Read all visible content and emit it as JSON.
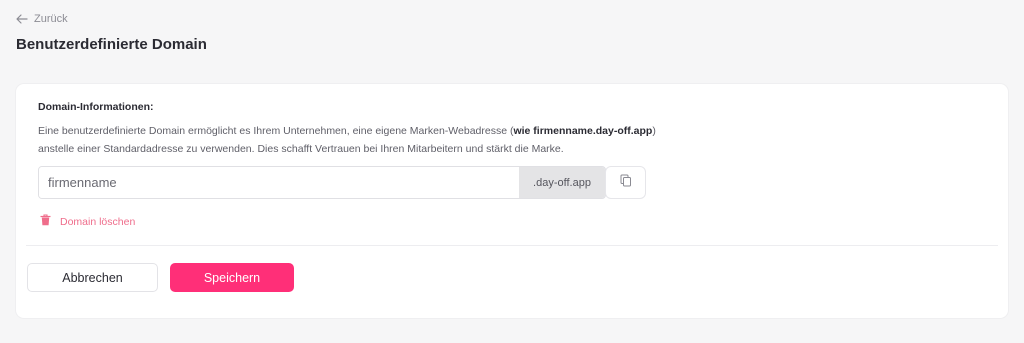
{
  "header": {
    "back_label": "Zurück",
    "title": "Benutzerdefinierte Domain"
  },
  "domain_section": {
    "heading": "Domain-Informationen:",
    "description_before": "Eine benutzerdefinierte Domain ermöglicht es Ihrem Unternehmen, eine eigene Marken-Webadresse (",
    "description_bold": "wie firmenname.day-off.app",
    "description_after": ") anstelle einer Standardadresse zu verwenden. Dies schafft Vertrauen bei Ihren Mitarbeitern und stärkt die Marke.",
    "input_placeholder": "firmenname",
    "input_value": "",
    "domain_suffix": ".day-off.app",
    "copy_icon": "copy-icon",
    "delete_label": "Domain löschen",
    "delete_icon": "trash-icon"
  },
  "actions": {
    "cancel_label": "Abbrechen",
    "save_label": "Speichern"
  },
  "colors": {
    "accent": "#ff2f78",
    "danger_text": "#ef6d8b",
    "background": "#f6f6f7"
  }
}
